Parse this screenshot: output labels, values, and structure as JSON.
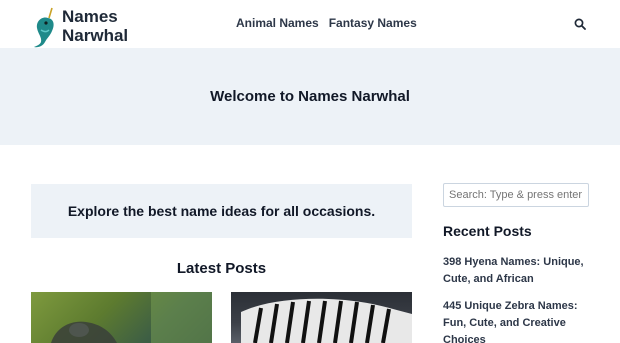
{
  "header": {
    "logo_line1": "Names",
    "logo_line2": "Narwhal",
    "nav": [
      "Animal Names",
      "Fantasy Names"
    ]
  },
  "hero": {
    "title": "Welcome to Names Narwhal"
  },
  "intro": {
    "text": "Explore the best name ideas for all occasions."
  },
  "latest": {
    "title": "Latest Posts"
  },
  "sidebar": {
    "search_placeholder": "Search: Type & press enter!",
    "recent_title": "Recent Posts",
    "recent_posts": [
      "398 Hyena Names: Unique, Cute, and African",
      "445 Unique Zebra Names: Fun, Cute, and Creative Choices"
    ]
  },
  "colors": {
    "hero_bg": "#edf2f7",
    "logo_teal": "#1f8a8a"
  },
  "icons": [
    "narwhal-logo-icon",
    "search-icon"
  ]
}
